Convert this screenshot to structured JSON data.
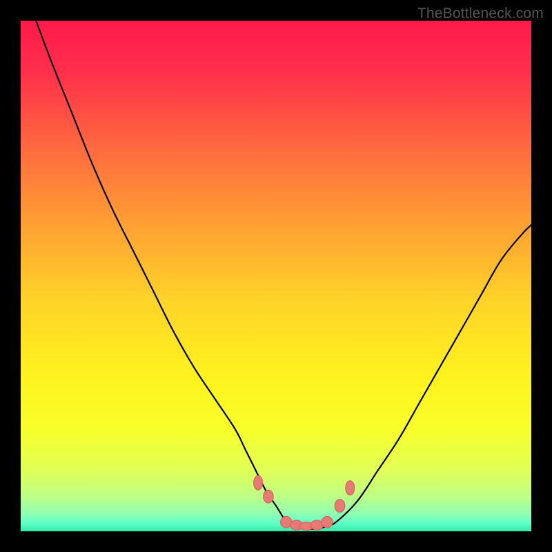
{
  "watermark": "TheBottleneck.com",
  "colors": {
    "frame": "#000000",
    "gradient_stops": [
      {
        "offset": 0.0,
        "color": "#ff1a4b"
      },
      {
        "offset": 0.1,
        "color": "#ff2f4b"
      },
      {
        "offset": 0.25,
        "color": "#ff6a3f"
      },
      {
        "offset": 0.4,
        "color": "#ffa033"
      },
      {
        "offset": 0.55,
        "color": "#ffd428"
      },
      {
        "offset": 0.7,
        "color": "#fff31f"
      },
      {
        "offset": 0.8,
        "color": "#f8ff2a"
      },
      {
        "offset": 0.88,
        "color": "#e2ff57"
      },
      {
        "offset": 0.93,
        "color": "#bfff84"
      },
      {
        "offset": 0.965,
        "color": "#90ffb2"
      },
      {
        "offset": 0.985,
        "color": "#5effc8"
      },
      {
        "offset": 1.0,
        "color": "#32e8a6"
      }
    ],
    "curve": "#000000",
    "markers_fill": "#e77a74",
    "markers_stroke": "#cf5e57"
  },
  "chart_data": {
    "type": "line",
    "title": "",
    "xlabel": "",
    "ylabel": "",
    "xlim": [
      0,
      100
    ],
    "ylim": [
      0,
      100
    ],
    "grid": false,
    "legend": false,
    "series": [
      {
        "name": "bottleneck-curve",
        "x": [
          3,
          6,
          10,
          14,
          18,
          22,
          26,
          30,
          34,
          38,
          42,
          44,
          46,
          48,
          50,
          52,
          54,
          56,
          58,
          60,
          62,
          66,
          70,
          74,
          78,
          82,
          86,
          90,
          94,
          98,
          100
        ],
        "y": [
          100,
          92,
          82,
          72,
          63,
          55,
          47,
          39,
          32,
          26,
          20,
          16,
          12,
          8,
          5,
          2,
          1,
          0.5,
          0.5,
          1,
          2,
          6,
          12,
          18,
          25,
          32,
          39,
          46,
          53,
          58,
          60
        ]
      }
    ],
    "markers": {
      "name": "bottom-markers",
      "x": [
        46.5,
        48.5,
        52,
        54,
        56,
        58,
        60,
        62.5,
        64.5
      ],
      "y": [
        9.5,
        6.8,
        1.8,
        1.2,
        1.0,
        1.2,
        1.8,
        5.0,
        8.5
      ]
    }
  }
}
